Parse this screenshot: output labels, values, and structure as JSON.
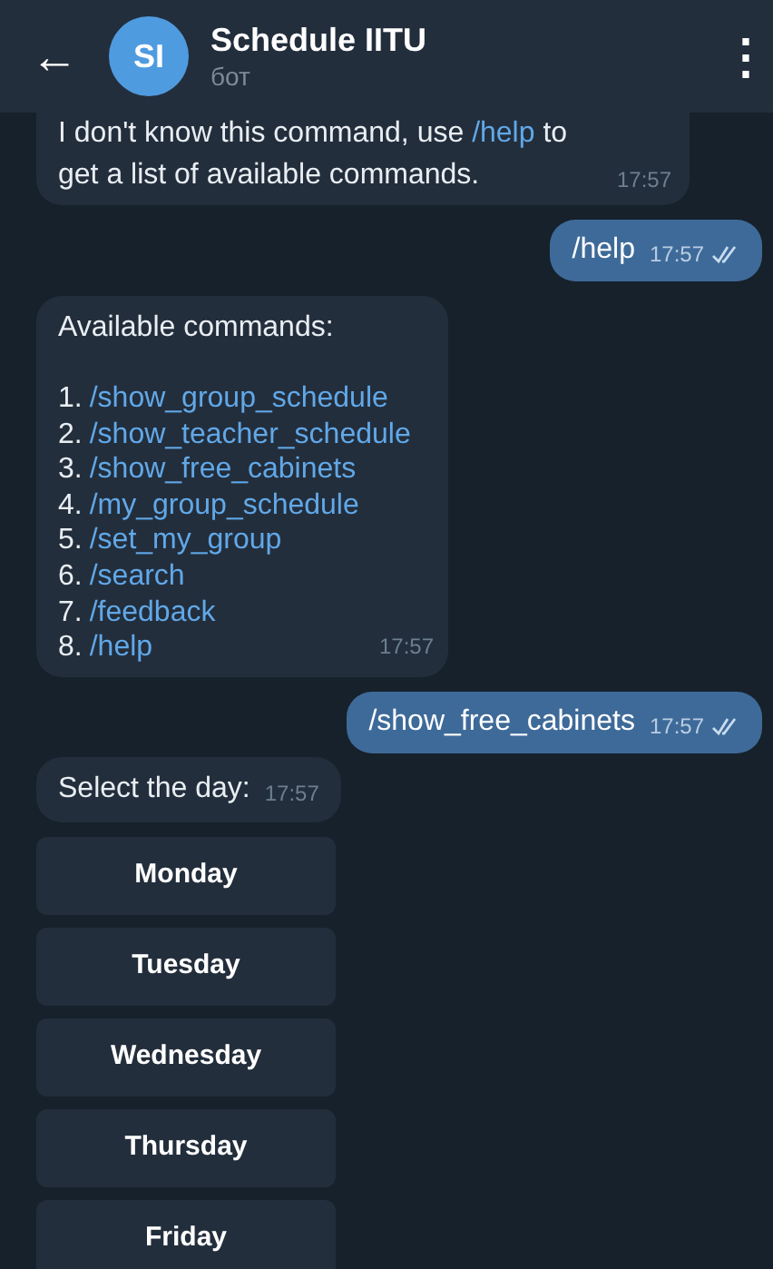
{
  "header": {
    "back": "←",
    "avatar": "SI",
    "title": "Schedule IITU",
    "subtitle": "бот",
    "menu": "⋮"
  },
  "messages": [
    {
      "kind": "incoming",
      "text_before": "I don't know this command, use ",
      "link": "/help",
      "text_after": " to get a list of available commands.",
      "time": "17:57"
    },
    {
      "kind": "outgoing",
      "text": "/help",
      "time": "17:57",
      "read": true
    },
    {
      "kind": "command_list",
      "intro": "Available commands:",
      "items": [
        {
          "number": "1.",
          "command": "/show_group_schedule"
        },
        {
          "number": "2.",
          "command": "/show_teacher_schedule"
        },
        {
          "number": "3.",
          "command": "/show_free_cabinets"
        },
        {
          "number": "4.",
          "command": "/my_group_schedule"
        },
        {
          "number": "5.",
          "command": "/set_my_group"
        },
        {
          "number": "6.",
          "command": "/search"
        },
        {
          "number": "7.",
          "command": "/feedback"
        },
        {
          "number": "8.",
          "command": "/help"
        }
      ],
      "time": "17:57"
    },
    {
      "kind": "outgoing",
      "text": "/show_free_cabinets",
      "time": "17:57",
      "read": true
    },
    {
      "kind": "incoming",
      "text": "Select the day:",
      "time": "17:57"
    }
  ],
  "keyboard": [
    "Monday",
    "Tuesday",
    "Wednesday",
    "Thursday",
    "Friday"
  ]
}
